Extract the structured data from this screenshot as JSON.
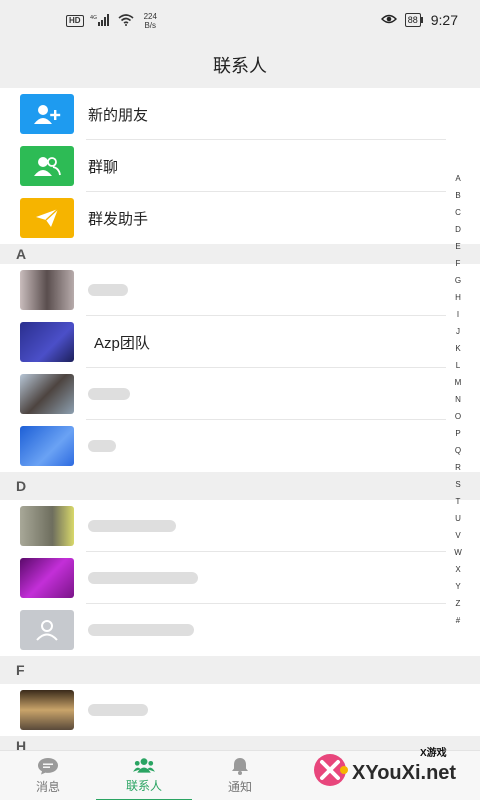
{
  "status_bar": {
    "left_badge": "HD",
    "signal": "4G",
    "net_speed_value": "224",
    "net_speed_unit": "B/s",
    "battery": "88",
    "time": "9:27"
  },
  "header": {
    "title": "联系人"
  },
  "top_actions": [
    {
      "label": "新的朋友",
      "icon": "add-user-icon",
      "color": "#1e9bf0"
    },
    {
      "label": "群聊",
      "icon": "group-icon",
      "color": "#2dbb55"
    },
    {
      "label": "群发助手",
      "icon": "paper-plane-icon",
      "color": "#f6b400"
    }
  ],
  "sections": [
    {
      "letter": "A",
      "contacts": [
        {
          "label": "",
          "avatar_color": "#7a6f6f"
        },
        {
          "label": "Azp团队",
          "avatar_color": "#3b3ea6"
        },
        {
          "label": "",
          "avatar_color": "#6c7d8c"
        },
        {
          "label": "",
          "avatar_color": "#3e7ce2"
        }
      ]
    },
    {
      "letter": "D",
      "contacts": [
        {
          "label": "",
          "avatar_color": "#8a8a7a"
        },
        {
          "label": "",
          "avatar_color": "#a01cb2"
        },
        {
          "label": "",
          "avatar_color": "#c6c9ce"
        }
      ]
    },
    {
      "letter": "F",
      "contacts": [
        {
          "label": "",
          "avatar_color": "#7a5a3a"
        }
      ]
    },
    {
      "letter": "H",
      "contacts": []
    }
  ],
  "alpha_index": [
    "A",
    "B",
    "C",
    "D",
    "E",
    "F",
    "G",
    "H",
    "I",
    "J",
    "K",
    "L",
    "M",
    "N",
    "O",
    "P",
    "Q",
    "R",
    "S",
    "T",
    "U",
    "V",
    "W",
    "X",
    "Y",
    "Z",
    "#"
  ],
  "tabs": [
    {
      "label": "消息",
      "icon": "chat-bubble-icon",
      "active": false
    },
    {
      "label": "联系人",
      "icon": "contacts-icon",
      "active": true
    },
    {
      "label": "通知",
      "icon": "bell-icon",
      "active": false
    }
  ],
  "watermark": {
    "text": "XYouXi.net",
    "small": "X游戏"
  },
  "colors": {
    "accent": "#2aa462",
    "header_bg": "#efefef"
  }
}
